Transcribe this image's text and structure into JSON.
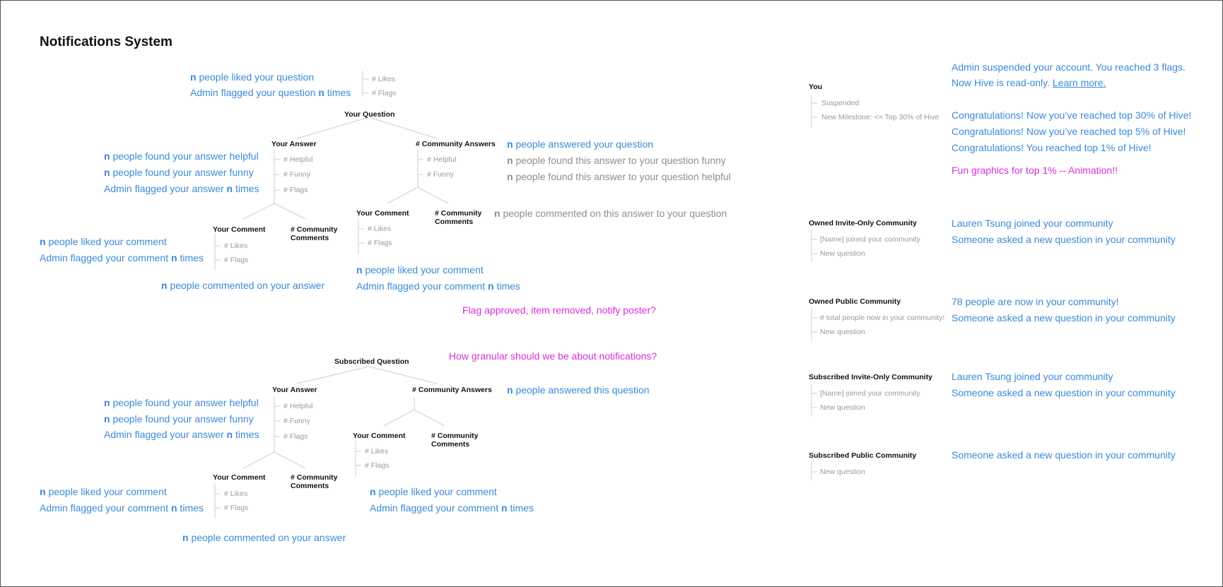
{
  "title": "Notifications System",
  "n": "n",
  "question_tree": {
    "root": "Your Question",
    "root_stats": [
      "# Likes",
      "# Flags"
    ],
    "root_notes": [
      "people liked your question",
      "Admin flagged your question",
      "times"
    ],
    "your_answer": "Your Answer",
    "your_answer_stats": [
      "# Helpful",
      "# Funny",
      "# Flags"
    ],
    "your_answer_notes": [
      "people found your answer helpful",
      "people found your answer funny",
      "Admin flagged your answer",
      "times"
    ],
    "community_answers": "# Community Answers",
    "community_answers_stats": [
      "# Helpful",
      "# Funny"
    ],
    "community_answers_notes": [
      "people answered your question",
      "people found this answer to your question funny",
      "people found this answer to your question helpful"
    ],
    "your_comment": "Your Comment",
    "your_comment_stats": [
      "# Likes",
      "# Flags"
    ],
    "your_comment_notes": [
      "people liked your comment",
      "Admin flagged your comment",
      "times"
    ],
    "community_comments": "# Community Comments",
    "answer_comments_note": "people commented on your answer",
    "ca_your_comment": "Your Comment",
    "ca_your_comment_stats": [
      "# Likes",
      "# Flags"
    ],
    "ca_community_comments": "# Community Comments",
    "ca_comments_gray_note": "people commented on this answer to your question",
    "ca_comment_notes": [
      "people liked your comment",
      "Admin flagged your comment",
      "times"
    ]
  },
  "questions_magenta": [
    "Flag approved, item removed, notify poster?",
    "How granular should we be about notifications?"
  ],
  "subscribed_tree": {
    "root": "Subscribed Question",
    "your_answer": "Your Answer",
    "your_answer_stats": [
      "# Helpful",
      "# Funny",
      "# Flags"
    ],
    "your_answer_notes": [
      "people found your answer helpful",
      "people found your answer funny",
      "Admin flagged your answer",
      "times"
    ],
    "community_answers": "# Community Answers",
    "community_answers_note": "people answered this question",
    "your_comment": "Your Comment",
    "your_comment_stats": [
      "# Likes",
      "# Flags"
    ],
    "your_comment_notes": [
      "people liked your comment",
      "Admin flagged your comment",
      "times"
    ],
    "community_comments": "# Community Comments",
    "answer_comments_note": "people commented on your answer",
    "ca_your_comment": "Your Comment",
    "ca_your_comment_stats": [
      "# Likes",
      "# Flags"
    ],
    "ca_community_comments": "# Community Comments",
    "ca_comment_notes": [
      "people liked your comment",
      "Admin flagged your comment",
      "times"
    ]
  },
  "you": {
    "label": "You",
    "items": [
      "Suspended",
      "New Milestone: <=  Top 30% of Hive"
    ],
    "notes": [
      "Admin suspended your account. You reached 3 flags.",
      "Now Hive is read-only.",
      "Learn more.",
      "Congratulations! Now you’ve reached top 30% of Hive!",
      "Congratulations! Now you’ve reached top 5% of Hive!",
      "Congratulations!  You reached top 1% of Hive!"
    ],
    "fun_note": "Fun graphics for top 1%  -- Animation!!"
  },
  "communities": [
    {
      "label": "Owned Invite-Only Community",
      "items": [
        "[Name] joined your community",
        "New question"
      ],
      "notes": [
        "Lauren Tsung joined your community",
        "Someone asked a new question in your community"
      ]
    },
    {
      "label": "Owned Public Community",
      "items": [
        "# total people now in your community!",
        "New question"
      ],
      "notes": [
        "78 people are now in your community!",
        "Someone asked a new question in your community"
      ]
    },
    {
      "label": "Subscribed Invite-Only Community",
      "items": [
        "[Name] joined your community",
        "New question"
      ],
      "notes": [
        "Lauren Tsung joined your community",
        "Someone asked a new question in your community"
      ]
    },
    {
      "label": "Subscribed Public Community",
      "items": [
        "New question"
      ],
      "notes": [
        "Someone asked a new question in your community"
      ]
    }
  ]
}
